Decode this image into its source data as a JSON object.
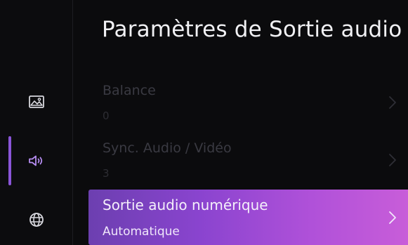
{
  "header": {
    "title": "Paramètres de Sortie audio"
  },
  "sidebar": {
    "items": [
      {
        "id": "picture",
        "icon": "picture-icon",
        "active": false
      },
      {
        "id": "sound",
        "icon": "speaker-icon",
        "active": true
      },
      {
        "id": "network",
        "icon": "globe-icon",
        "active": false
      }
    ],
    "accent": "#8a55d8"
  },
  "settings": {
    "rows": [
      {
        "label": "Balance",
        "value": "0",
        "icon": "chevron-right-icon"
      },
      {
        "label": "Sync. Audio / Vidéo",
        "value": "3",
        "icon": "chevron-right-icon"
      },
      {
        "label": "Sortie audio numérique",
        "value": "Automatique",
        "icon": "chevron-right-icon",
        "focused": true
      }
    ]
  },
  "colors": {
    "background": "#0b0b0d",
    "focus_gradient_start": "#6c3fb0",
    "focus_gradient_end": "#c85dd9"
  }
}
